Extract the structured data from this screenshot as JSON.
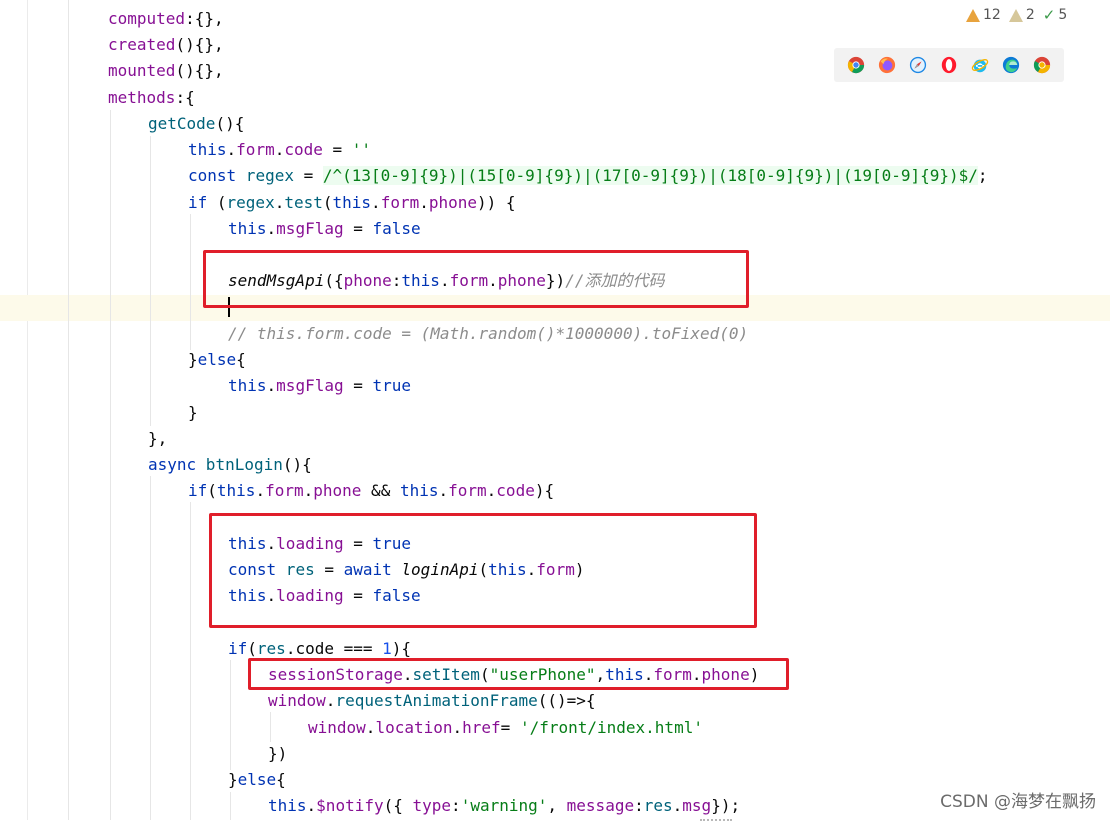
{
  "inspections": {
    "warnings": "12",
    "weak_warnings": "2",
    "ok_checks": "5"
  },
  "browsers": [
    "chrome-icon",
    "firefox-icon",
    "safari-icon",
    "opera-icon",
    "ie-icon",
    "edge-icon",
    "chrome-beta-icon"
  ],
  "watermark": "CSDN @海梦在飘扬",
  "code": {
    "l1_a": "computed",
    "l1_b": ":{},",
    "l2_a": "created",
    "l2_b": "(){},",
    "l3_a": "mounted",
    "l3_b": "(){},",
    "l4_a": "methods",
    "l4_b": ":{",
    "l5_a": "getCode",
    "l5_b": "(){",
    "l6_kw": "this",
    "l6_a": ".",
    "l6_p1": "form",
    "l6_b": ".",
    "l6_p2": "code",
    "l6_c": " = ",
    "l6_s": "''",
    "l7_kw": "const",
    "l7_v": " regex",
    "l7_a": " = ",
    "l7_rx": "/^(13[0-9]{9})|(15[0-9]{9})|(17[0-9]{9})|(18[0-9]{9})|(19[0-9]{9})$/",
    "l7_b": ";",
    "l8_kw": "if",
    "l8_a": " (",
    "l8_v": "regex",
    "l8_b": ".",
    "l8_f": "test",
    "l8_c": "(",
    "l8_kw2": "this",
    "l8_d": ".",
    "l8_p1": "form",
    "l8_e": ".",
    "l8_p2": "phone",
    "l8_g": ")) {",
    "l9_kw": "this",
    "l9_a": ".",
    "l9_p": "msgFlag",
    "l9_b": " = ",
    "l9_kw2": "false",
    "l11_f": "sendMsgApi",
    "l11_a": "({",
    "l11_p": "phone",
    "l11_b": ":",
    "l11_kw": "this",
    "l11_c": ".",
    "l11_p1": "form",
    "l11_d": ".",
    "l11_p2": "phone",
    "l11_e": "})",
    "l11_cm": "//添加的代码",
    "l13_cm": "// this.form.code = (Math.random()*1000000).toFixed(0)",
    "l14_a": "}",
    "l14_kw": "else",
    "l14_b": "{",
    "l15_kw": "this",
    "l15_a": ".",
    "l15_p": "msgFlag",
    "l15_b": " = ",
    "l15_kw2": "true",
    "l16_a": "}",
    "l17_a": "},",
    "l18_kw": "async",
    "l18_f": " btnLogin",
    "l18_a": "(){",
    "l19_kw": "if",
    "l19_a": "(",
    "l19_kw2": "this",
    "l19_b": ".",
    "l19_p1": "form",
    "l19_c": ".",
    "l19_p2": "phone",
    "l19_d": " && ",
    "l19_kw3": "this",
    "l19_e": ".",
    "l19_p3": "form",
    "l19_g": ".",
    "l19_p4": "code",
    "l19_h": "){",
    "l21_kw": "this",
    "l21_a": ".",
    "l21_p": "loading",
    "l21_b": " = ",
    "l21_kw2": "true",
    "l22_kw": "const",
    "l22_v": " res",
    "l22_a": " = ",
    "l22_kw2": "await",
    "l22_f": " loginApi",
    "l22_b": "(",
    "l22_kw3": "this",
    "l22_c": ".",
    "l22_p": "form",
    "l22_d": ")",
    "l23_kw": "this",
    "l23_a": ".",
    "l23_p": "loading",
    "l23_b": " = ",
    "l23_kw2": "false",
    "l25_kw": "if",
    "l25_a": "(",
    "l25_v": "res",
    "l25_b": ".code === ",
    "l25_n": "1",
    "l25_c": "){",
    "l26_p": "sessionStorage",
    "l26_a": ".",
    "l26_f": "setItem",
    "l26_b": "(",
    "l26_s": "\"userPhone\"",
    "l26_c": ",",
    "l26_kw": "this",
    "l26_d": ".",
    "l26_p1": "form",
    "l26_e": ".",
    "l26_p2": "phone",
    "l26_g": ")",
    "l27_p": "window",
    "l27_a": ".",
    "l27_f": "requestAnimationFrame",
    "l27_b": "(()=>{",
    "l28_p": "window",
    "l28_a": ".",
    "l28_p1": "location",
    "l28_b": ".",
    "l28_p2": "href",
    "l28_c": "= ",
    "l28_s": "'/front/index.html'",
    "l29_a": "})",
    "l30_a": "}",
    "l30_kw": "else",
    "l30_b": "{",
    "l31_kw": "this",
    "l31_a": ".",
    "l31_p": "$notify",
    "l31_b": "({ ",
    "l31_k1": "type",
    "l31_c": ":",
    "l31_s": "'warning'",
    "l31_d": ", ",
    "l31_k2": "message",
    "l31_e": ":",
    "l31_v": "res",
    "l31_g": ".",
    "l31_p2": "msg",
    "l31_h": "});"
  }
}
